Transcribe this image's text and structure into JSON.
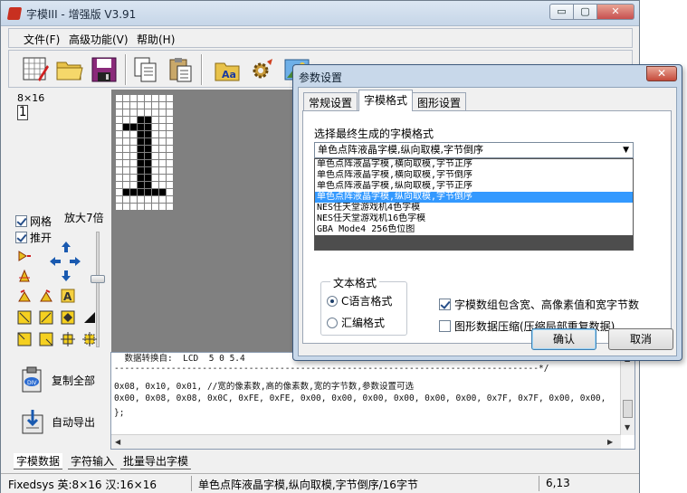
{
  "app": {
    "title": "字模III - 增强版 V3.91",
    "window_buttons": {
      "minimize": "▭",
      "maximize": "▢",
      "close": "✕"
    }
  },
  "menu": {
    "file": "文件(F)",
    "advanced": "高级功能(V)",
    "help": "帮助(H)"
  },
  "toolbar_icons": [
    "new-grid-icon",
    "open-folder-icon",
    "save-disk-icon",
    "copy-icon",
    "paste-icon",
    "font-icon",
    "settings-gear-icon",
    "image-icon"
  ],
  "glyph": {
    "size_label": "8×16",
    "char": "1",
    "bitmap": [
      "00000000",
      "00000000",
      "00000000",
      "00011000",
      "01111000",
      "00011000",
      "00011000",
      "00011000",
      "00011000",
      "00011000",
      "00011000",
      "00011000",
      "00011000",
      "01111110",
      "00000000",
      "00000000"
    ]
  },
  "left_panel": {
    "grid_label": "网格",
    "push_label": "推开",
    "grid_checked": true,
    "push_checked": true,
    "zoom_label": "放大7倍"
  },
  "actions": {
    "copy_all": "复制全部",
    "auto_export": "自动导出"
  },
  "code": {
    "lines": [
      "  数据转换自:  LCD  5 0 5.4",
      "----------------------------------------------------------------------------------*/",
      "0x08, 0x10, 0x01, //宽的像素数,高的像素数,宽的字节数,参数设置可选",
      "0x00, 0x08, 0x08, 0x0C, 0xFE, 0xFE, 0x00, 0x00, 0x00, 0x00, 0x00, 0x00, 0x7F, 0x7F, 0x00, 0x00,",
      "};"
    ]
  },
  "bottom_tabs": [
    "字模数据",
    "字符输入",
    "批量导出字模"
  ],
  "status": {
    "font": "Fixedsys 英:8×16 汉:16×16",
    "mode": "单色点阵液晶字模,纵向取模,字节倒序/16字节",
    "pos": "6,13"
  },
  "dialog": {
    "title": "参数设置",
    "tabs": [
      "常规设置",
      "字模格式",
      "图形设置"
    ],
    "active_tab": 1,
    "format_label": "选择最终生成的字模格式",
    "selected_format": "单色点阵液晶字模,纵向取模,字节倒序",
    "format_options": [
      "单色点阵液晶字模,横向取模,字节正序",
      "单色点阵液晶字模,横向取模,字节倒序",
      "单色点阵液晶字模,纵向取模,字节正序",
      "单色点阵液晶字模,纵向取模,字节倒序",
      "NES任天堂游戏机4色字模",
      "NES任天堂游戏机16色字模",
      "GBA Mode4 256色位图"
    ],
    "selected_index": 3,
    "text_format_legend": "文本格式",
    "radio_c": "C语言格式",
    "radio_asm": "汇编格式",
    "chk_include": "字模数组包含宽、高像素值和宽字节数",
    "chk_compress": "图形数据压缩(压缩局部重复数据)",
    "include_checked": true,
    "compress_checked": false,
    "ok": "确认",
    "cancel": "取消",
    "close": "✕"
  },
  "colors": {
    "selection": "#3399ff",
    "dialog_frame": "#c8d8ea",
    "canvas_bg": "#808080"
  }
}
